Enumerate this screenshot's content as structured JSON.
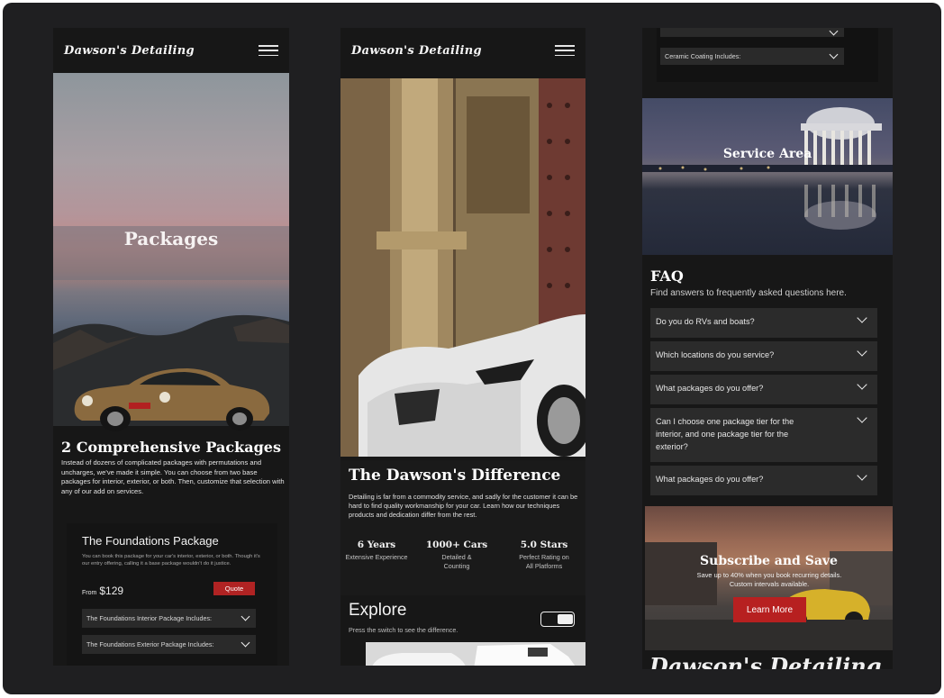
{
  "brand": "Dawson's Detailing",
  "packages_page": {
    "hero_title": "Packages",
    "intro_title": "2 Comprehensive Packages",
    "intro_text": "Instead of dozens of complicated packages with permutations and uncharges, we've made it simple. You can choose from two base packages for interior, exterior, or both. Then, customize that selection with any of our add on services.",
    "package": {
      "title": "The Foundations Package",
      "desc": "You can book this package for your car's interior, exterior, or both. Though it's our entry offering, calling it a base package wouldn't do it justice.",
      "from_label": "From",
      "price": "$129",
      "quote_label": "Quote",
      "accordions": [
        "The Foundations Interior Package Includes:",
        "The Foundations Exterior Package Includes:"
      ]
    }
  },
  "home_page": {
    "diff_title": "The Dawson's Difference",
    "diff_text": "Detailing is far from a commodity service, and sadly for the customer it can be hard to find quality workmanship for your car. Learn how our techniques products and dedication differ from the rest.",
    "stats": [
      {
        "big": "6 Years",
        "small": "Extensive Experience"
      },
      {
        "big": "1000+ Cars",
        "small": "Detailed & Counting"
      },
      {
        "big": "5.0 Stars",
        "small": "Perfect Rating on All Platforms"
      }
    ],
    "explore_title": "Explore",
    "explore_text": "Press the switch to see the difference."
  },
  "info_page": {
    "top_accordions": [
      "Ceramic Coating Includes:"
    ],
    "service_area": "Service Area",
    "faq_title": "FAQ",
    "faq_sub": "Find answers to frequently asked questions here.",
    "faqs": [
      "Do you do RVs and boats?",
      "Which locations do you service?",
      "What packages do you offer?",
      "Can I choose one package tier for the interior, and one package tier for the exterior?",
      "What packages do you offer?"
    ],
    "subscribe_title": "Subscribe and Save",
    "subscribe_text": "Save up to 40% when you book recurring details. Custom intervals available.",
    "learn_more": "Learn More",
    "footer_logo": "Dawson's Detailing"
  },
  "colors": {
    "accent": "#b02323",
    "background": "#1f1f21"
  }
}
